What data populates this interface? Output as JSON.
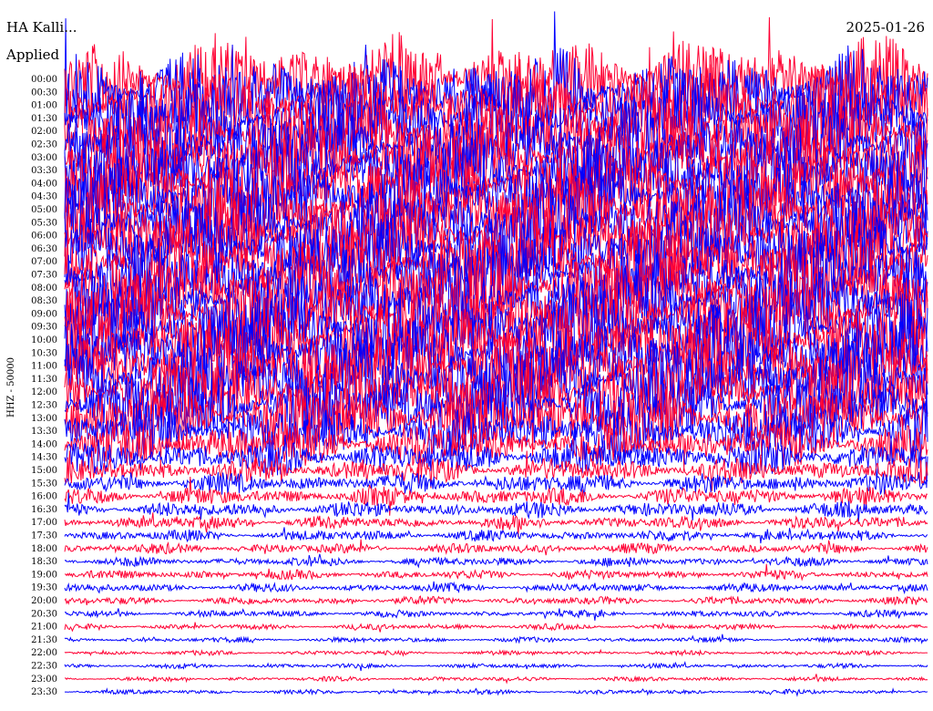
{
  "header": {
    "station": "HA Kalli...",
    "applied": "Applied",
    "date": "2025-01-26"
  },
  "chart_data": {
    "type": "line",
    "title": "",
    "ylabel": "HHZ - 50000",
    "xlabel": "",
    "tick_labels": [
      "00:00",
      "00:30",
      "01:00",
      "01:30",
      "02:00",
      "02:30",
      "03:00",
      "03:30",
      "04:00",
      "04:30",
      "05:00",
      "05:30",
      "06:00",
      "06:30",
      "07:00",
      "07:30",
      "08:00",
      "08:30",
      "09:00",
      "09:30",
      "10:00",
      "10:30",
      "11:00",
      "11:30",
      "12:00",
      "12:30",
      "13:00",
      "13:30",
      "14:00",
      "14:30",
      "15:00",
      "15:30",
      "16:00",
      "16:30",
      "17:00",
      "17:30",
      "18:00",
      "18:30",
      "19:00",
      "19:30",
      "20:00",
      "20:30",
      "21:00",
      "21:30",
      "22:00",
      "22:30",
      "23:00",
      "23:30"
    ],
    "row_colors": [
      "#ff0033",
      "#0000ff"
    ],
    "amplitude_relative": [
      7.5,
      7.5,
      7.5,
      7.5,
      7.5,
      7.5,
      7.5,
      7.5,
      7.5,
      7.5,
      7.5,
      7.5,
      7.5,
      7.5,
      7.5,
      7.5,
      7.5,
      7.5,
      7.5,
      7.5,
      7.5,
      7.5,
      7.5,
      7.5,
      7.0,
      6.5,
      6.0,
      5.0,
      4.0,
      3.0,
      2.2,
      1.8,
      1.6,
      1.4,
      1.2,
      1.0,
      0.9,
      0.8,
      0.8,
      0.75,
      0.7,
      0.6,
      0.5,
      0.45,
      0.4,
      0.4,
      0.4,
      0.4
    ],
    "grid": false,
    "legend": "none"
  }
}
